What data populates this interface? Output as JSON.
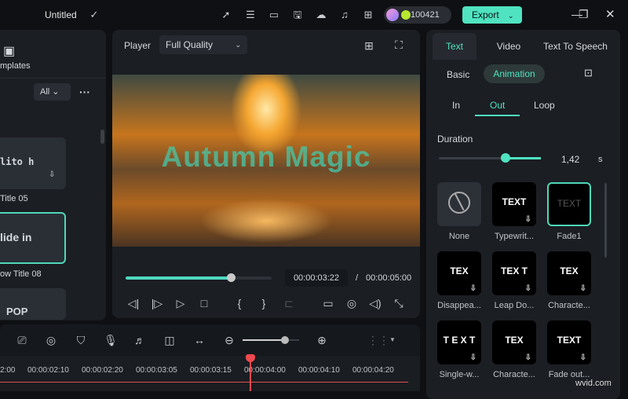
{
  "topbar": {
    "title": "Untitled",
    "credits": "100421",
    "export_label": "Export",
    "icons": [
      "send-icon",
      "task-list-icon",
      "layout-icon",
      "save-icon",
      "cloud-upload-icon",
      "headset-icon",
      "apps-grid-icon"
    ]
  },
  "left_panel": {
    "tab_label": "mplates",
    "filter": "All",
    "items": [
      {
        "preview": "lito h",
        "label": "Title 05"
      },
      {
        "preview": "lide in",
        "label": "ow Title 08"
      },
      {
        "preview": "POP",
        "label": ""
      }
    ]
  },
  "player": {
    "label": "Player",
    "quality": "Full Quality",
    "overlay_text": "Autumn Magic",
    "current_time": "00:00:03:22",
    "total_time": "00:00:05:00",
    "progress": 0.72
  },
  "right_panel": {
    "tabs": [
      "Text",
      "Video",
      "Text To Speech"
    ],
    "active_tab": "Text",
    "subtabs": [
      "Basic",
      "Animation"
    ],
    "active_subtab": "Animation",
    "anim_tabs": [
      "In",
      "Out",
      "Loop"
    ],
    "active_anim_tab": "Out",
    "duration_label": "Duration",
    "duration_value": "1,42",
    "duration_unit": "s",
    "duration_fraction": 0.65,
    "presets": [
      {
        "label": "None",
        "preview": ""
      },
      {
        "label": "Typewrit...",
        "preview": "TEXT"
      },
      {
        "label": "Fade1",
        "preview": "TEXT"
      },
      {
        "label": "Disappea...",
        "preview": "TEX"
      },
      {
        "label": "Leap Do...",
        "preview": "TEX T"
      },
      {
        "label": "Characte...",
        "preview": "TEX"
      },
      {
        "label": "Single-w...",
        "preview": "T E X T"
      },
      {
        "label": "Characte...",
        "preview": "TEX"
      },
      {
        "label": "Fade out...",
        "preview": "TEXT"
      }
    ],
    "selected_preset": "Fade1"
  },
  "timeline": {
    "zoom_fraction": 0.75,
    "ticks": [
      "2:00",
      "00:00:02:10",
      "00:00:02:20",
      "00:00:03:05",
      "00:00:03:15",
      "00:00:04:00",
      "00:00:04:10",
      "00:00:04:20"
    ]
  },
  "watermark": "wvid.com",
  "colors": {
    "accent": "#4fe3c1",
    "playhead": "#f0494f"
  }
}
